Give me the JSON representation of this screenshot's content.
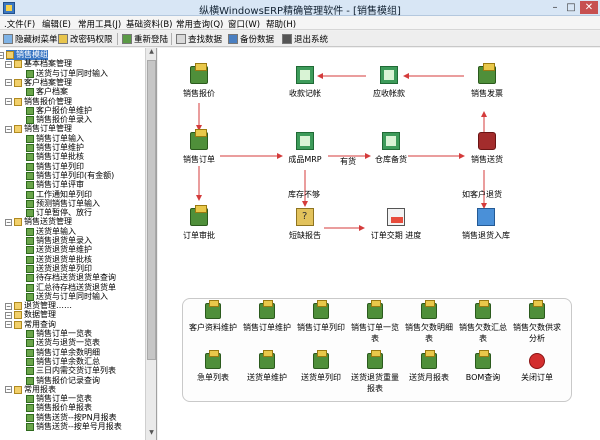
{
  "window": {
    "title": "纵横WindowsERP精确管理软件 - [销售模组]"
  },
  "menu": [
    ".文件(F)",
    "编辑(E)",
    "常用工具(J)",
    "基础资料(B)",
    "常用查询(Q)",
    "窗口(W)",
    "帮助(H)"
  ],
  "toolbar": [
    "隐藏树菜单",
    "改密码权限",
    "重新登陆",
    "查找数据",
    "备份数据",
    "退出系统"
  ],
  "tree": [
    {
      "label": "销售模组",
      "level": 0,
      "kind": "folder",
      "sel": true
    },
    {
      "label": "基本档案管理",
      "level": 1,
      "kind": "folder"
    },
    {
      "label": "送货与订单同时输入",
      "level": 2,
      "kind": "doc"
    },
    {
      "label": "客户档案管理",
      "level": 1,
      "kind": "folder"
    },
    {
      "label": "客户档案",
      "level": 2,
      "kind": "doc"
    },
    {
      "label": "销售报价管理",
      "level": 1,
      "kind": "folder"
    },
    {
      "label": "客户报价单维护",
      "level": 2,
      "kind": "doc"
    },
    {
      "label": "销售报价单录入",
      "level": 2,
      "kind": "doc"
    },
    {
      "label": "销售订单管理",
      "level": 1,
      "kind": "folder"
    },
    {
      "label": "销售订单输入",
      "level": 2,
      "kind": "doc"
    },
    {
      "label": "销售订单维护",
      "level": 2,
      "kind": "doc"
    },
    {
      "label": "销售订单批核",
      "level": 2,
      "kind": "doc"
    },
    {
      "label": "销售订单列印",
      "level": 2,
      "kind": "doc"
    },
    {
      "label": "销售订单列印(有金额)",
      "level": 2,
      "kind": "doc"
    },
    {
      "label": "销售订单评审",
      "level": 2,
      "kind": "doc"
    },
    {
      "label": "工作通知单列印",
      "level": 2,
      "kind": "doc"
    },
    {
      "label": "预测销售订单输入",
      "level": 2,
      "kind": "doc"
    },
    {
      "label": "订单暂停、放行",
      "level": 2,
      "kind": "doc"
    },
    {
      "label": "销售送货管理",
      "level": 1,
      "kind": "folder"
    },
    {
      "label": "送货单输入",
      "level": 2,
      "kind": "doc"
    },
    {
      "label": "销售退货单录入",
      "level": 2,
      "kind": "doc"
    },
    {
      "label": "送货退货单维护",
      "level": 2,
      "kind": "doc"
    },
    {
      "label": "送货退货单批核",
      "level": 2,
      "kind": "doc"
    },
    {
      "label": "送货退货单列印",
      "level": 2,
      "kind": "doc"
    },
    {
      "label": "待存档送货退货单查询",
      "level": 2,
      "kind": "doc"
    },
    {
      "label": "汇总待存档送货退货单",
      "level": 2,
      "kind": "doc"
    },
    {
      "label": "送货与订单同时输入",
      "level": 2,
      "kind": "doc"
    },
    {
      "label": "退货管理……",
      "level": 1,
      "kind": "folder"
    },
    {
      "label": "数据管理",
      "level": 1,
      "kind": "folder"
    },
    {
      "label": "常用查询",
      "level": 1,
      "kind": "folder"
    },
    {
      "label": "销售订单一览表",
      "level": 2,
      "kind": "doc"
    },
    {
      "label": "送货与退货一览表",
      "level": 2,
      "kind": "doc"
    },
    {
      "label": "销售订单余数明细",
      "level": 2,
      "kind": "doc"
    },
    {
      "label": "销售订单余数汇总",
      "level": 2,
      "kind": "doc"
    },
    {
      "label": "三日内需交货订单列表",
      "level": 2,
      "kind": "doc"
    },
    {
      "label": "销售报价记录查询",
      "level": 2,
      "kind": "doc"
    },
    {
      "label": "常用报表",
      "level": 1,
      "kind": "folder"
    },
    {
      "label": "销售订单一览表",
      "level": 2,
      "kind": "doc"
    },
    {
      "label": "销售报价单报表",
      "level": 2,
      "kind": "doc"
    },
    {
      "label": "销售送货--按PN月报表",
      "level": 2,
      "kind": "doc"
    },
    {
      "label": "销售送货--按单号月报表",
      "level": 2,
      "kind": "doc"
    }
  ],
  "flow": {
    "nodes": [
      {
        "id": "quote",
        "label": "销售报价",
        "icon": "printer"
      },
      {
        "id": "collect",
        "label": "收款记帐",
        "icon": "book"
      },
      {
        "id": "ar",
        "label": "应收帐款",
        "icon": "book"
      },
      {
        "id": "invoice",
        "label": "销售发票",
        "icon": "printer"
      },
      {
        "id": "order",
        "label": "销售订单",
        "icon": "printer"
      },
      {
        "id": "mrp",
        "label": "成品MRP",
        "icon": "book"
      },
      {
        "id": "warehouse",
        "label": "仓库备货",
        "icon": "book"
      },
      {
        "id": "ship",
        "label": "销售送货",
        "icon": "truck"
      },
      {
        "id": "approve",
        "label": "订单审批",
        "icon": "printer"
      },
      {
        "id": "shortage",
        "label": "短缺报告",
        "icon": "report"
      },
      {
        "id": "progress",
        "label": "订单交期 进度",
        "icon": "stock"
      },
      {
        "id": "return",
        "label": "销售退货入库",
        "icon": "return"
      }
    ],
    "edge_labels": {
      "stock_ok": "有货",
      "stock_short": "库存不够",
      "return_case": "如客户退货"
    }
  },
  "buttons": [
    "客户资料维护",
    "销售订单维护",
    "销售订单列印",
    "销售订单一览表",
    "销售欠数明细表",
    "销售欠数汇总表",
    "销售欠数供求分析",
    "急单列表",
    "送货单维护",
    "送货单列印",
    "送货退货重量报表",
    "送货月报表",
    "BOM查询",
    "关闭订单"
  ]
}
